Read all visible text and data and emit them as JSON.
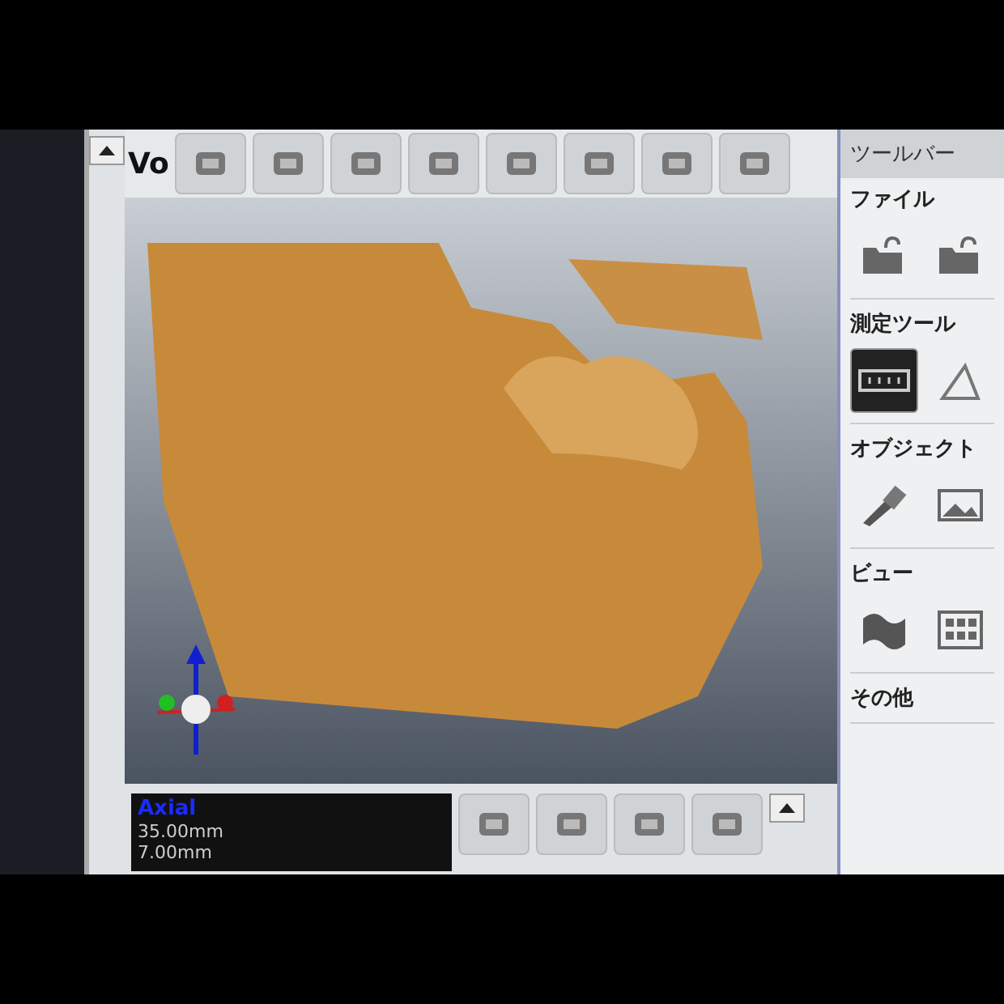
{
  "main_view": {
    "title": "Vo",
    "axial_preview": {
      "label": "Axial",
      "lines": [
        "35.00mm",
        "7.00mm"
      ]
    }
  },
  "toolbar_panel": {
    "tab": "ツールバー",
    "sections": [
      {
        "title": "ファイル",
        "tools": [
          {
            "kind": "folder",
            "selected": false
          },
          {
            "kind": "folder",
            "selected": false
          }
        ]
      },
      {
        "title": "測定ツール",
        "tools": [
          {
            "kind": "ruler",
            "selected": true
          },
          {
            "kind": "angle",
            "selected": false
          }
        ]
      },
      {
        "title": "オブジェクト",
        "tools": [
          {
            "kind": "brush",
            "selected": false
          },
          {
            "kind": "image",
            "selected": false
          }
        ]
      },
      {
        "title": "ビュー",
        "tools": [
          {
            "kind": "surface",
            "selected": false
          },
          {
            "kind": "grid",
            "selected": false
          }
        ]
      },
      {
        "title": "その他"
      }
    ]
  }
}
